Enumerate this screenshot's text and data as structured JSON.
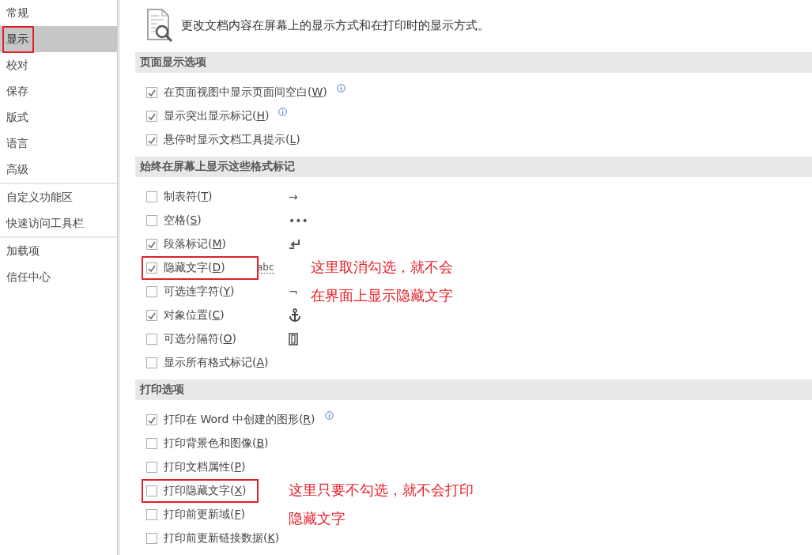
{
  "sidebar": {
    "groups": [
      {
        "items": [
          {
            "label": "常规",
            "selected": false,
            "annotated": false
          },
          {
            "label": "显示",
            "selected": true,
            "annotated": true
          },
          {
            "label": "校对",
            "selected": false,
            "annotated": false
          },
          {
            "label": "保存",
            "selected": false,
            "annotated": false
          },
          {
            "label": "版式",
            "selected": false,
            "annotated": false
          },
          {
            "label": "语言",
            "selected": false,
            "annotated": false
          },
          {
            "label": "高级",
            "selected": false,
            "annotated": false
          }
        ]
      },
      {
        "items": [
          {
            "label": "自定义功能区",
            "selected": false,
            "annotated": false
          },
          {
            "label": "快速访问工具栏",
            "selected": false,
            "annotated": false
          }
        ]
      },
      {
        "items": [
          {
            "label": "加载项",
            "selected": false,
            "annotated": false
          },
          {
            "label": "信任中心",
            "selected": false,
            "annotated": false
          }
        ]
      }
    ]
  },
  "header": {
    "text": "更改文档内容在屏幕上的显示方式和在打印时的显示方式。"
  },
  "sections": [
    {
      "title": "页面显示选项",
      "options": [
        {
          "label": "在页面视图中显示页面间空白(W)",
          "checked": true,
          "info": true,
          "annotated": false
        },
        {
          "label": "显示突出显示标记(H)",
          "checked": true,
          "info": true,
          "annotated": false
        },
        {
          "label": "悬停时显示文档工具提示(L)",
          "checked": true,
          "info": false,
          "annotated": false
        }
      ]
    },
    {
      "title": "始终在屏幕上显示这些格式标记",
      "note": {
        "lines": [
          "这里取消勾选，就不会",
          "在界面上显示隐藏文字"
        ]
      },
      "options": [
        {
          "label": "制表符(T)",
          "checked": false,
          "info": false,
          "annotated": false,
          "mark": {
            "kind": "char",
            "symbol": "→"
          }
        },
        {
          "label": "空格(S)",
          "checked": false,
          "info": false,
          "annotated": false,
          "mark": {
            "kind": "char",
            "symbol": "•••"
          }
        },
        {
          "label": "段落标记(M)",
          "checked": true,
          "info": false,
          "annotated": false,
          "mark": {
            "kind": "return"
          }
        },
        {
          "label": "隐藏文字(D)",
          "checked": true,
          "info": false,
          "annotated": true,
          "mark": {
            "kind": "dotted",
            "symbol": "abc"
          }
        },
        {
          "label": "可选连字符(Y)",
          "checked": false,
          "info": false,
          "annotated": false,
          "mark": {
            "kind": "char",
            "symbol": "¬"
          }
        },
        {
          "label": "对象位置(C)",
          "checked": true,
          "info": false,
          "annotated": false,
          "mark": {
            "kind": "anchor"
          }
        },
        {
          "label": "可选分隔符(O)",
          "checked": false,
          "info": false,
          "annotated": false,
          "mark": {
            "kind": "break"
          }
        },
        {
          "label": "显示所有格式标记(A)",
          "checked": false,
          "info": false,
          "annotated": false
        }
      ]
    },
    {
      "title": "打印选项",
      "note": {
        "lines": [
          "这里只要不勾选，就不会打印",
          "隐藏文字"
        ]
      },
      "options": [
        {
          "label": "打印在 Word 中创建的图形(R)",
          "checked": true,
          "info": true,
          "annotated": false
        },
        {
          "label": "打印背景色和图像(B)",
          "checked": false,
          "info": false,
          "annotated": false
        },
        {
          "label": "打印文档属性(P)",
          "checked": false,
          "info": false,
          "annotated": false
        },
        {
          "label": "打印隐藏文字(X)",
          "checked": false,
          "info": false,
          "annotated": true
        },
        {
          "label": "打印前更新域(F)",
          "checked": false,
          "info": false,
          "annotated": false
        },
        {
          "label": "打印前更新链接数据(K)",
          "checked": false,
          "info": false,
          "annotated": false
        }
      ]
    }
  ]
}
